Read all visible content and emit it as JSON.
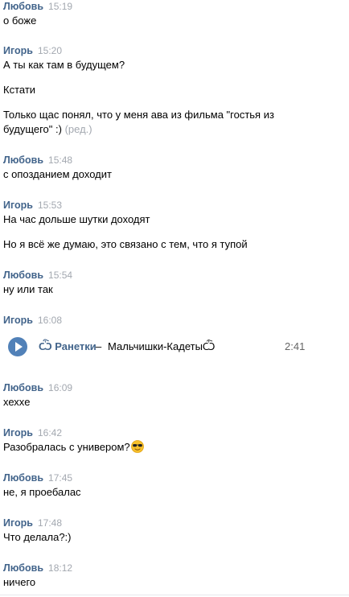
{
  "messages": [
    {
      "author": "Любовь",
      "time": "15:19",
      "lines": [
        "о боже"
      ]
    },
    {
      "author": "Игорь",
      "time": "15:20",
      "lines": [
        "А ты как там в будущем?",
        "Кстати",
        "Только щас понял, что у меня ава из фильма \"гостья из",
        "будущего\" :)"
      ],
      "edited": "(ред.)"
    },
    {
      "author": "Любовь",
      "time": "15:48",
      "lines": [
        "с опозданием доходит"
      ]
    },
    {
      "author": "Игорь",
      "time": "15:53",
      "lines": [
        "На час дольше шутки доходят",
        "Но я всё же думаю, это связано с тем, что я тупой"
      ]
    },
    {
      "author": "Любовь",
      "time": "15:54",
      "lines": [
        "ну или так"
      ]
    },
    {
      "author": "Игорь",
      "time": "16:08",
      "audio": {
        "artist": "Ѽ Ранетки",
        "separator": "–",
        "title": "Мальчишки-КадетыѼ",
        "duration": "2:41"
      }
    },
    {
      "author": "Любовь",
      "time": "16:09",
      "lines": [
        "хехxe"
      ]
    },
    {
      "author": "Игорь",
      "time": "16:42",
      "lines": [
        "Разобралась с универом?"
      ],
      "emoji": "sunglasses-emoji"
    },
    {
      "author": "Любовь",
      "time": "17:45",
      "lines": [
        "не, я проебалас"
      ]
    },
    {
      "author": "Игорь",
      "time": "17:48",
      "lines": [
        "Что делала?:)"
      ]
    },
    {
      "author": "Любовь",
      "time": "18:12",
      "lines": [
        "ничего"
      ]
    }
  ],
  "colors": {
    "author": "#42648b",
    "time": "#a3a8b0",
    "play_button": "#5181b8",
    "text": "#000000",
    "duration": "#656565"
  }
}
